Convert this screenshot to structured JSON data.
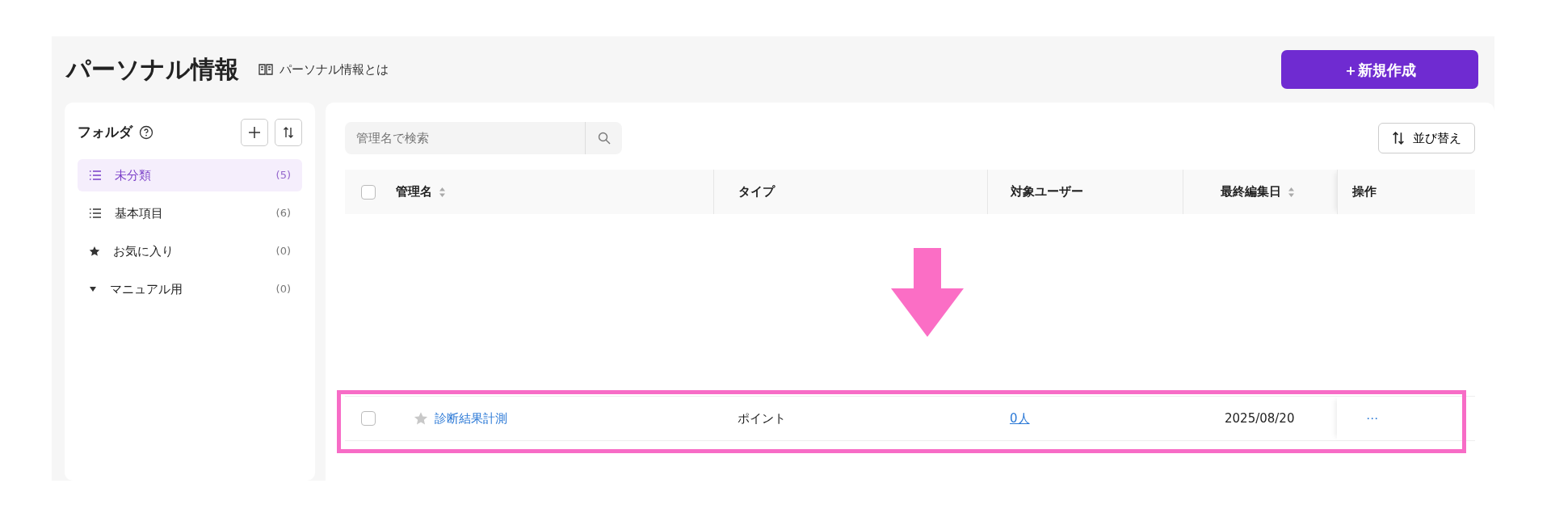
{
  "header": {
    "title": "パーソナル情報",
    "help_link": "パーソナル情報とは",
    "new_button": "＋新規作成"
  },
  "sidebar": {
    "title": "フォルダ",
    "items": [
      {
        "kind": "list",
        "label": "未分類",
        "count": "(5)",
        "selected": true
      },
      {
        "kind": "list",
        "label": "基本項目",
        "count": "(6)",
        "selected": false
      },
      {
        "kind": "star",
        "label": "お気に入り",
        "count": "(0)",
        "selected": false
      },
      {
        "kind": "caret",
        "label": "マニュアル用",
        "count": "(0)",
        "selected": false
      }
    ]
  },
  "search": {
    "placeholder": "管理名で検索"
  },
  "sort_button": "並び替え",
  "table": {
    "header_checked": false,
    "columns": [
      {
        "label": "管理名",
        "sortable": true
      },
      {
        "label": "タイプ",
        "sortable": false
      },
      {
        "label": "対象ユーザー",
        "sortable": false
      },
      {
        "label": "最終編集日",
        "sortable": true
      },
      {
        "label": "操作",
        "sortable": false
      }
    ],
    "rows": [
      {
        "checked": false,
        "starred": false,
        "name": "診断結果計測",
        "type": "ポイント",
        "users": "0人",
        "date": "2025/08/20",
        "actions": "⋯"
      }
    ]
  },
  "annotations": {
    "arrow": true,
    "highlight_frame": true
  }
}
